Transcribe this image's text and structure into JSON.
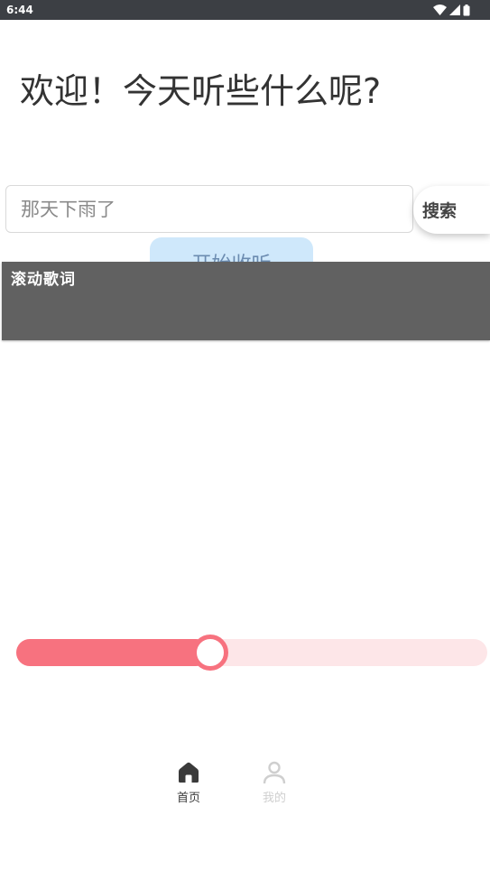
{
  "status_bar": {
    "time": "6:44",
    "icons": [
      "wifi-icon",
      "signal-icon",
      "battery-icon"
    ]
  },
  "greeting": "欢迎！今天听些什么呢?",
  "search": {
    "placeholder": "那天下雨了",
    "button_label": "搜索"
  },
  "listen_button_label": "开始收听",
  "lyrics_overlay": {
    "title": "滚动歌词"
  },
  "slider": {
    "progress_percent": 41
  },
  "tabs": [
    {
      "label": "首页",
      "icon": "home-icon",
      "active": true
    },
    {
      "label": "我的",
      "icon": "person-icon",
      "active": false
    }
  ],
  "colors": {
    "accent": "#f7727f",
    "track": "#fde6e8",
    "listen_button_bg": "#cfe8fb",
    "overlay_bg": "#616161",
    "status_bar_bg": "#3c3f44"
  }
}
